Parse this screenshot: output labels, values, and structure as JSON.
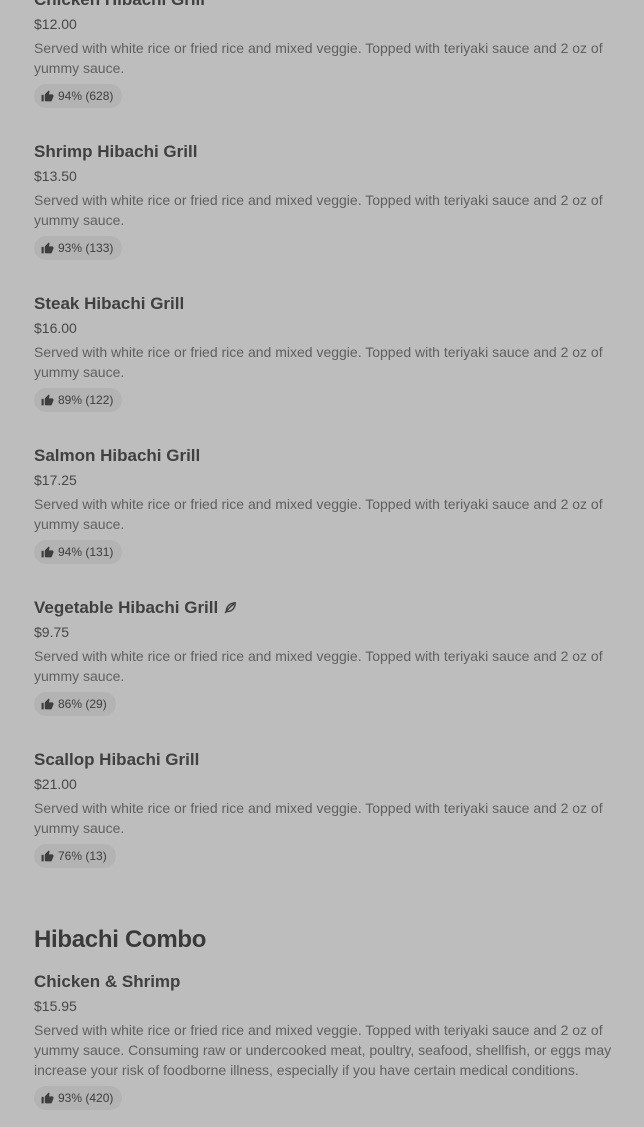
{
  "items": [
    {
      "name": "Chicken Hibachi Grill",
      "price": "$12.00",
      "description": "Served with white rice or fried rice and mixed veggie. Topped with teriyaki sauce and 2 oz of yummy sauce.",
      "rating": "94% (628)"
    },
    {
      "name": "Shrimp Hibachi Grill",
      "price": "$13.50",
      "description": "Served with white rice or fried rice and mixed veggie. Topped with teriyaki sauce and 2 oz of yummy sauce.",
      "rating": "93% (133)"
    },
    {
      "name": "Steak Hibachi Grill",
      "price": "$16.00",
      "description": "Served with white rice or fried rice and mixed veggie. Topped with teriyaki sauce and 2 oz of yummy sauce.",
      "rating": "89% (122)"
    },
    {
      "name": "Salmon Hibachi Grill",
      "price": "$17.25",
      "description": "Served with white rice or fried rice and mixed veggie. Topped with teriyaki sauce and 2 oz of yummy sauce.",
      "rating": "94% (131)"
    },
    {
      "name": "Vegetable Hibachi Grill",
      "price": "$9.75",
      "description": "Served with white rice or fried rice and mixed veggie. Topped with teriyaki sauce and 2 oz of yummy sauce.",
      "rating": "86% (29)"
    },
    {
      "name": "Scallop Hibachi Grill",
      "price": "$21.00",
      "description": "Served with white rice or fried rice and mixed veggie. Topped with teriyaki sauce and 2 oz of yummy sauce.",
      "rating": "76% (13)"
    }
  ],
  "combo_section": {
    "title": "Hibachi Combo",
    "items": [
      {
        "name": "Chicken & Shrimp",
        "price": "$15.95",
        "description": "Served with white rice or fried rice and mixed veggie. Topped with teriyaki sauce and 2 oz of yummy sauce. Consuming raw or undercooked meat, poultry, seafood, shellfish, or eggs may increase your risk of foodborne illness, especially if you have certain medical conditions.",
        "rating": "93% (420)"
      }
    ]
  },
  "icons": {
    "rating": "thumbs-up-icon",
    "vegetarian": "leaf-icon"
  },
  "colors": {
    "background": "#bdbdbd",
    "rating_pill": "#b3b3b3"
  }
}
